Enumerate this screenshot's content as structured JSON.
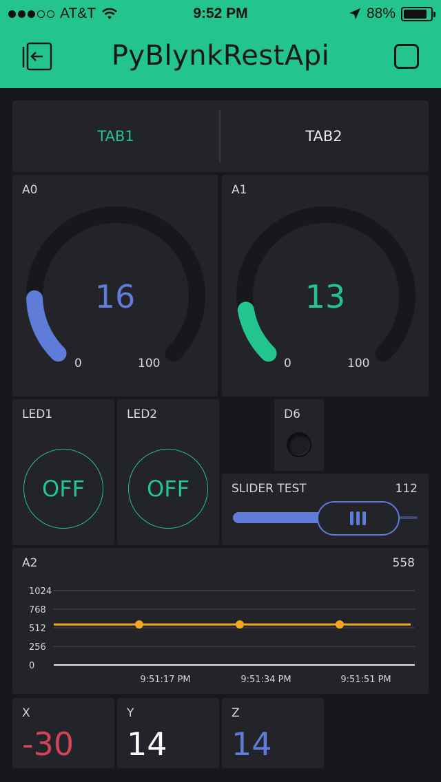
{
  "status_bar": {
    "carrier": "AT&T",
    "signal_bars_filled": 3,
    "signal_bars_total": 5,
    "time": "9:52 PM",
    "battery": "88%",
    "battery_level": 0.88,
    "icons": [
      "wifi-icon",
      "location-arrow-icon",
      "battery-icon"
    ]
  },
  "nav": {
    "title": "PyBlynkRestApi",
    "left_icon": "exit-project-icon",
    "right_icon": "stop-icon"
  },
  "tabs": [
    {
      "label": "TAB1",
      "active": true
    },
    {
      "label": "TAB2",
      "active": false
    }
  ],
  "gauges": [
    {
      "label": "A0",
      "value": "16",
      "min": "0",
      "max": "100",
      "fraction": 0.16,
      "color": "#5f7cd8"
    },
    {
      "label": "A1",
      "value": "13",
      "min": "0",
      "max": "100",
      "fraction": 0.13,
      "color": "#23c48e"
    }
  ],
  "leds": [
    {
      "label": "LED1",
      "button_text": "OFF"
    },
    {
      "label": "LED2",
      "button_text": "OFF"
    }
  ],
  "d6": {
    "label": "D6",
    "state": "off"
  },
  "slider": {
    "label": "SLIDER TEST",
    "value": "112",
    "min": 0,
    "max": 255,
    "color": "#5f7cd8"
  },
  "chart": {
    "label": "A2",
    "current_value": "558",
    "color": "#f5a623"
  },
  "chart_data": {
    "type": "line",
    "x": [
      "9:51:17 PM",
      "9:51:34 PM",
      "9:51:51 PM"
    ],
    "series": [
      {
        "values": [
          558,
          558,
          558
        ]
      }
    ],
    "yticks": [
      "1024",
      "768",
      "512",
      "256",
      "0"
    ],
    "ylim": [
      0,
      1024
    ],
    "grid": true
  },
  "accels": [
    {
      "label": "X",
      "value": "-30",
      "color": "#d3435c"
    },
    {
      "label": "Y",
      "value": "14",
      "color": "#ffffff"
    },
    {
      "label": "Z",
      "value": "14",
      "color": "#5f7cd8"
    }
  ],
  "colors": {
    "accent": "#23c48e",
    "background": "#17181c",
    "widget": "#22242a"
  }
}
